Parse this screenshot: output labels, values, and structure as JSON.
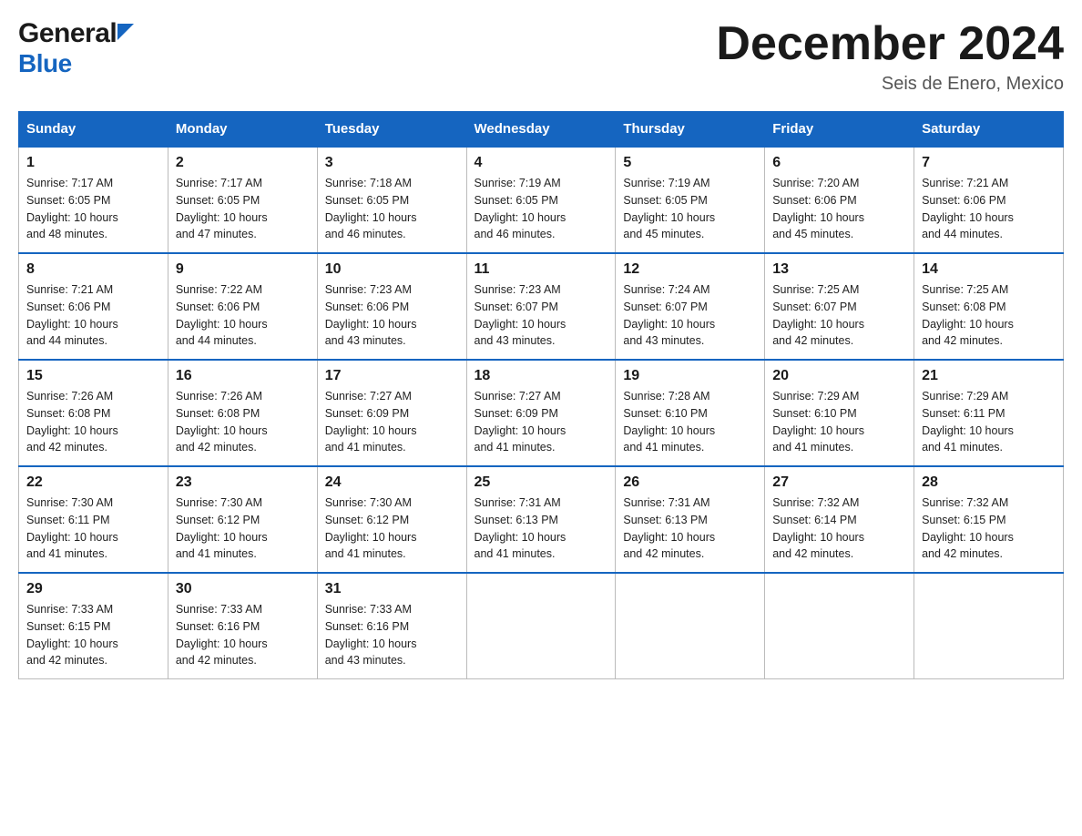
{
  "logo": {
    "text_general": "General",
    "text_blue": "Blue"
  },
  "title": "December 2024",
  "subtitle": "Seis de Enero, Mexico",
  "days_of_week": [
    "Sunday",
    "Monday",
    "Tuesday",
    "Wednesday",
    "Thursday",
    "Friday",
    "Saturday"
  ],
  "weeks": [
    [
      {
        "day": "1",
        "sunrise": "7:17 AM",
        "sunset": "6:05 PM",
        "daylight": "10 hours and 48 minutes."
      },
      {
        "day": "2",
        "sunrise": "7:17 AM",
        "sunset": "6:05 PM",
        "daylight": "10 hours and 47 minutes."
      },
      {
        "day": "3",
        "sunrise": "7:18 AM",
        "sunset": "6:05 PM",
        "daylight": "10 hours and 46 minutes."
      },
      {
        "day": "4",
        "sunrise": "7:19 AM",
        "sunset": "6:05 PM",
        "daylight": "10 hours and 46 minutes."
      },
      {
        "day": "5",
        "sunrise": "7:19 AM",
        "sunset": "6:05 PM",
        "daylight": "10 hours and 45 minutes."
      },
      {
        "day": "6",
        "sunrise": "7:20 AM",
        "sunset": "6:06 PM",
        "daylight": "10 hours and 45 minutes."
      },
      {
        "day": "7",
        "sunrise": "7:21 AM",
        "sunset": "6:06 PM",
        "daylight": "10 hours and 44 minutes."
      }
    ],
    [
      {
        "day": "8",
        "sunrise": "7:21 AM",
        "sunset": "6:06 PM",
        "daylight": "10 hours and 44 minutes."
      },
      {
        "day": "9",
        "sunrise": "7:22 AM",
        "sunset": "6:06 PM",
        "daylight": "10 hours and 44 minutes."
      },
      {
        "day": "10",
        "sunrise": "7:23 AM",
        "sunset": "6:06 PM",
        "daylight": "10 hours and 43 minutes."
      },
      {
        "day": "11",
        "sunrise": "7:23 AM",
        "sunset": "6:07 PM",
        "daylight": "10 hours and 43 minutes."
      },
      {
        "day": "12",
        "sunrise": "7:24 AM",
        "sunset": "6:07 PM",
        "daylight": "10 hours and 43 minutes."
      },
      {
        "day": "13",
        "sunrise": "7:25 AM",
        "sunset": "6:07 PM",
        "daylight": "10 hours and 42 minutes."
      },
      {
        "day": "14",
        "sunrise": "7:25 AM",
        "sunset": "6:08 PM",
        "daylight": "10 hours and 42 minutes."
      }
    ],
    [
      {
        "day": "15",
        "sunrise": "7:26 AM",
        "sunset": "6:08 PM",
        "daylight": "10 hours and 42 minutes."
      },
      {
        "day": "16",
        "sunrise": "7:26 AM",
        "sunset": "6:08 PM",
        "daylight": "10 hours and 42 minutes."
      },
      {
        "day": "17",
        "sunrise": "7:27 AM",
        "sunset": "6:09 PM",
        "daylight": "10 hours and 41 minutes."
      },
      {
        "day": "18",
        "sunrise": "7:27 AM",
        "sunset": "6:09 PM",
        "daylight": "10 hours and 41 minutes."
      },
      {
        "day": "19",
        "sunrise": "7:28 AM",
        "sunset": "6:10 PM",
        "daylight": "10 hours and 41 minutes."
      },
      {
        "day": "20",
        "sunrise": "7:29 AM",
        "sunset": "6:10 PM",
        "daylight": "10 hours and 41 minutes."
      },
      {
        "day": "21",
        "sunrise": "7:29 AM",
        "sunset": "6:11 PM",
        "daylight": "10 hours and 41 minutes."
      }
    ],
    [
      {
        "day": "22",
        "sunrise": "7:30 AM",
        "sunset": "6:11 PM",
        "daylight": "10 hours and 41 minutes."
      },
      {
        "day": "23",
        "sunrise": "7:30 AM",
        "sunset": "6:12 PM",
        "daylight": "10 hours and 41 minutes."
      },
      {
        "day": "24",
        "sunrise": "7:30 AM",
        "sunset": "6:12 PM",
        "daylight": "10 hours and 41 minutes."
      },
      {
        "day": "25",
        "sunrise": "7:31 AM",
        "sunset": "6:13 PM",
        "daylight": "10 hours and 41 minutes."
      },
      {
        "day": "26",
        "sunrise": "7:31 AM",
        "sunset": "6:13 PM",
        "daylight": "10 hours and 42 minutes."
      },
      {
        "day": "27",
        "sunrise": "7:32 AM",
        "sunset": "6:14 PM",
        "daylight": "10 hours and 42 minutes."
      },
      {
        "day": "28",
        "sunrise": "7:32 AM",
        "sunset": "6:15 PM",
        "daylight": "10 hours and 42 minutes."
      }
    ],
    [
      {
        "day": "29",
        "sunrise": "7:33 AM",
        "sunset": "6:15 PM",
        "daylight": "10 hours and 42 minutes."
      },
      {
        "day": "30",
        "sunrise": "7:33 AM",
        "sunset": "6:16 PM",
        "daylight": "10 hours and 42 minutes."
      },
      {
        "day": "31",
        "sunrise": "7:33 AM",
        "sunset": "6:16 PM",
        "daylight": "10 hours and 43 minutes."
      },
      null,
      null,
      null,
      null
    ]
  ],
  "labels": {
    "sunrise": "Sunrise:",
    "sunset": "Sunset:",
    "daylight": "Daylight:"
  }
}
